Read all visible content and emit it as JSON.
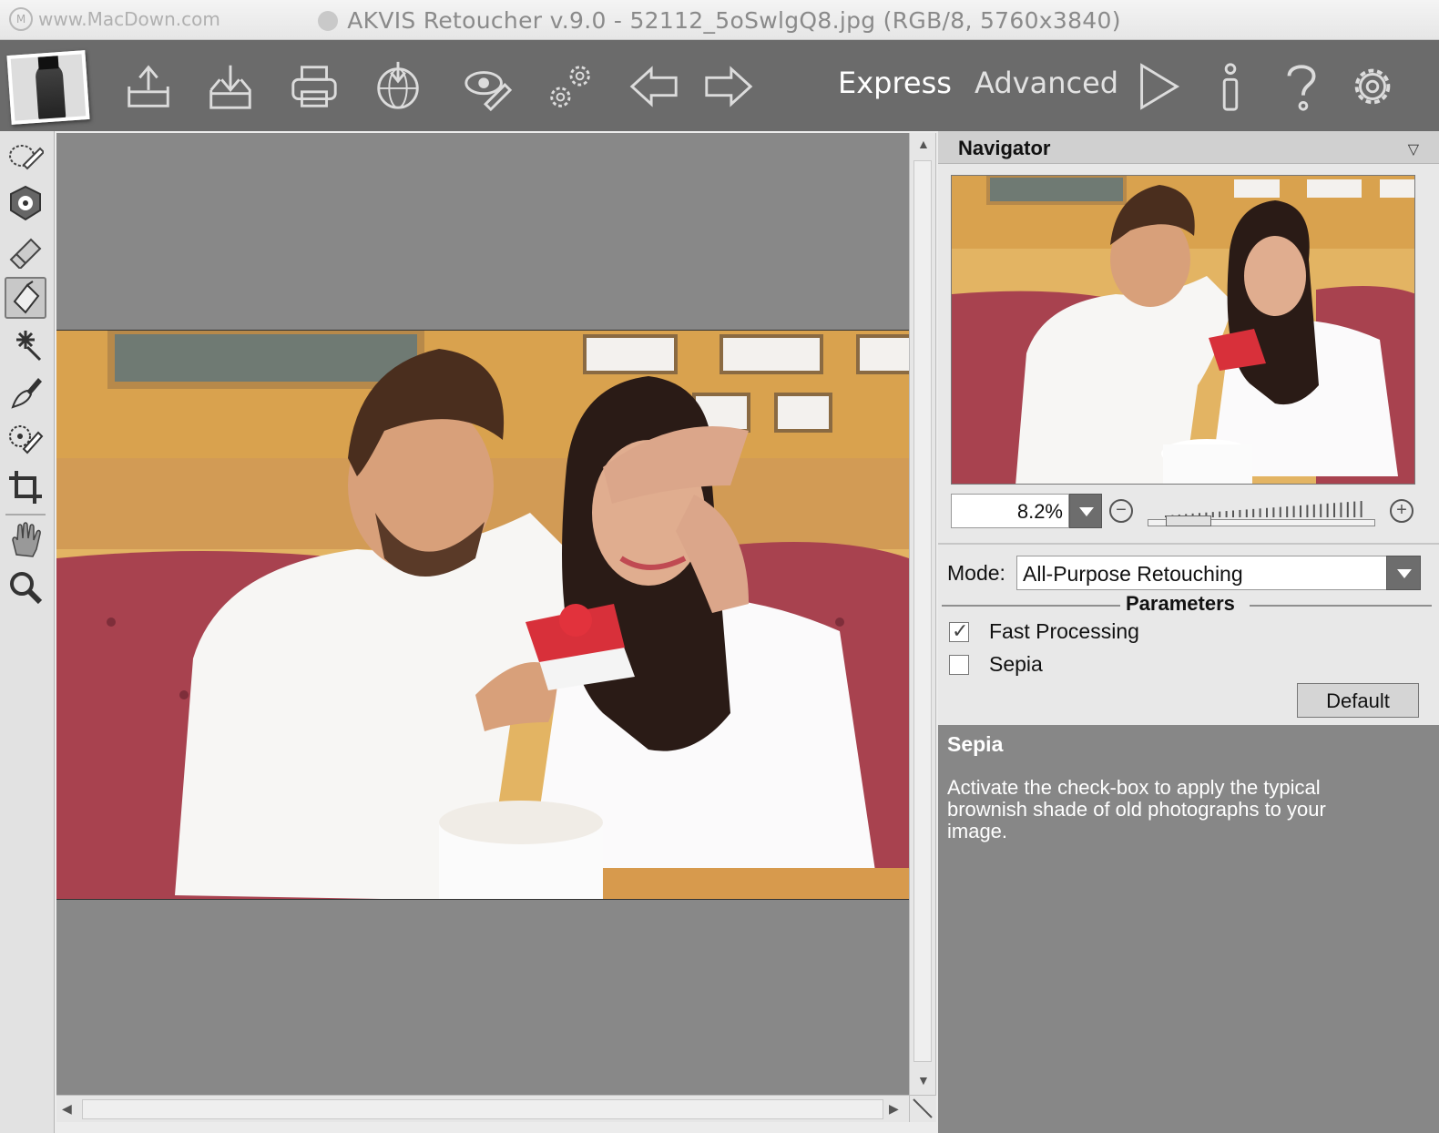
{
  "titlebar": {
    "watermark": "www.MacDown.com",
    "title": "AKVIS Retoucher v.9.0 - 52112_5oSwlgQ8.jpg (RGB/8, 5760x3840)"
  },
  "toolbar": {
    "buttons": [
      {
        "name": "open-image",
        "icon": "tray-upload-icon"
      },
      {
        "name": "save-image",
        "icon": "tray-download-icon"
      },
      {
        "name": "print-image",
        "icon": "printer-icon"
      },
      {
        "name": "share-image",
        "icon": "globe-download-icon"
      },
      {
        "name": "batch-processing",
        "icon": "eye-pen-icon"
      },
      {
        "name": "preferences-gears",
        "icon": "gears-icon"
      },
      {
        "name": "undo",
        "icon": "arrow-left-icon"
      },
      {
        "name": "redo",
        "icon": "arrow-right-icon"
      },
      {
        "name": "run",
        "icon": "play-icon"
      },
      {
        "name": "about",
        "icon": "info-icon"
      },
      {
        "name": "help",
        "icon": "question-icon"
      },
      {
        "name": "settings",
        "icon": "gear-icon"
      }
    ],
    "express_label": "Express",
    "advanced_label": "Advanced",
    "active_mode": "Express"
  },
  "tools": [
    "lasso-brush-icon",
    "shield-icon",
    "eraser-icon",
    "bucket-icon",
    "magic-wand-icon",
    "brush-icon",
    "clone-stamp-icon",
    "crop-icon",
    "hand-icon",
    "zoom-icon"
  ],
  "navigator": {
    "title": "Navigator",
    "zoom_value": "8.2%",
    "zoom_level_fraction": 0.1
  },
  "settings": {
    "mode_label": "Mode:",
    "mode_value": "All-Purpose Retouching",
    "parameters_title": "Parameters",
    "fast_processing_label": "Fast Processing",
    "fast_processing_checked": true,
    "sepia_label": "Sepia",
    "sepia_checked": false,
    "default_button": "Default"
  },
  "help": {
    "title": "Sepia",
    "text": "Activate the check-box to apply the typical brownish shade of old photographs to your image."
  },
  "colors": {
    "toolbar_bg": "#6b6b6b",
    "canvas_bg": "#888888",
    "help_bg": "#878787"
  }
}
